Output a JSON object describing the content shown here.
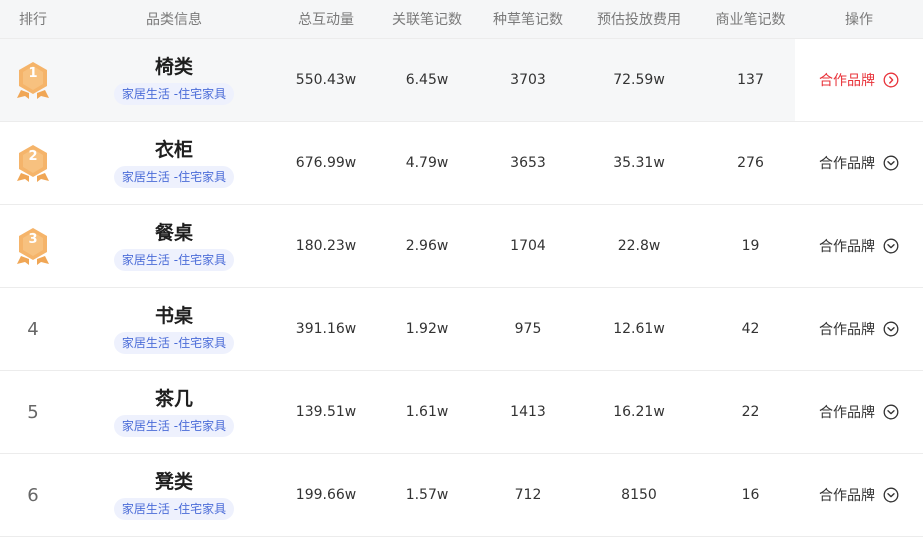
{
  "header": {
    "rank": "排行",
    "category_info": "品类信息",
    "total_interaction": "总互动量",
    "linked_notes": "关联笔记数",
    "seeding_notes": "种草笔记数",
    "estimated_cost": "预估投放费用",
    "commercial_notes": "商业笔记数",
    "action": "操作"
  },
  "rows": [
    {
      "rank": "1",
      "name": "椅类",
      "tag": "家居生活 -住宅家具",
      "total": "550.43w",
      "linked": "6.45w",
      "seeding": "3703",
      "cost": "72.59w",
      "commercial": "137",
      "action": "合作品牌"
    },
    {
      "rank": "2",
      "name": "衣柜",
      "tag": "家居生活 -住宅家具",
      "total": "676.99w",
      "linked": "4.79w",
      "seeding": "3653",
      "cost": "35.31w",
      "commercial": "276",
      "action": "合作品牌"
    },
    {
      "rank": "3",
      "name": "餐桌",
      "tag": "家居生活 -住宅家具",
      "total": "180.23w",
      "linked": "2.96w",
      "seeding": "1704",
      "cost": "22.8w",
      "commercial": "19",
      "action": "合作品牌"
    },
    {
      "rank": "4",
      "name": "书桌",
      "tag": "家居生活 -住宅家具",
      "total": "391.16w",
      "linked": "1.92w",
      "seeding": "975",
      "cost": "12.61w",
      "commercial": "42",
      "action": "合作品牌"
    },
    {
      "rank": "5",
      "name": "茶几",
      "tag": "家居生活 -住宅家具",
      "total": "139.51w",
      "linked": "1.61w",
      "seeding": "1413",
      "cost": "16.21w",
      "commercial": "22",
      "action": "合作品牌"
    },
    {
      "rank": "6",
      "name": "凳类",
      "tag": "家居生活 -住宅家具",
      "total": "199.66w",
      "linked": "1.57w",
      "seeding": "712",
      "cost": "8150",
      "commercial": "16",
      "action": "合作品牌"
    }
  ],
  "colors": {
    "medal": "#f5b46a",
    "tag_text": "#4b6cd8",
    "tag_bg": "#eef1fd",
    "active_action": "#e8343b"
  },
  "icons": {
    "medal": "medal-icon",
    "action_expanded": "chevron-right-circle-icon",
    "action_collapsed": "chevron-down-circle-icon"
  }
}
